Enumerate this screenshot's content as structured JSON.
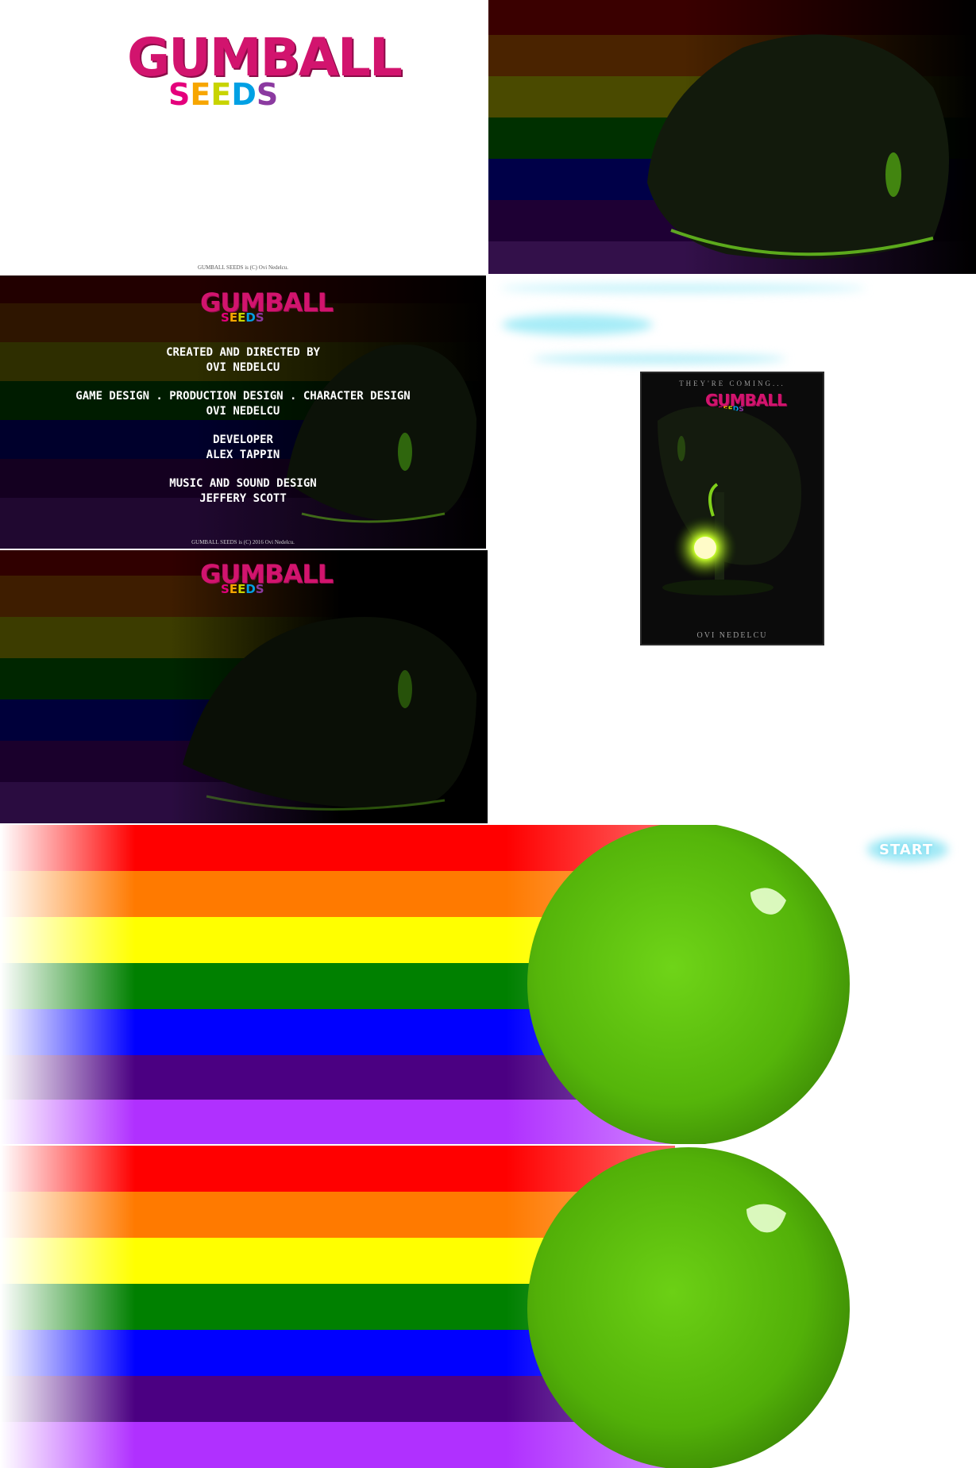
{
  "logo": {
    "top": "GUMBALL",
    "seeds_letters": [
      {
        "ch": "S",
        "color": "#e4007c"
      },
      {
        "ch": "E",
        "color": "#f7a600"
      },
      {
        "ch": "E",
        "color": "#c8d400"
      },
      {
        "ch": "D",
        "color": "#00a0e4"
      },
      {
        "ch": "S",
        "color": "#8b3aa0"
      }
    ]
  },
  "title_screen": {
    "copyright": "GUMBALL SEEDS is (C) Ovi Nedelcu."
  },
  "credits_screen": {
    "copyright": "GUMBALL SEEDS is (C) 2016 Ovi Nedelcu.",
    "roles": [
      {
        "title": "Created and Directed by",
        "name": "Ovi Nedelcu"
      },
      {
        "title": "Game Design . Production Design . Character Design",
        "name": "Ovi Nedelcu"
      },
      {
        "title": "Developer",
        "name": "Alex Tappin"
      },
      {
        "title": "Music and Sound Design",
        "name": "Jeffery Scott"
      }
    ]
  },
  "poster": {
    "tagline": "THEY'RE COMING...",
    "credit": "OVI NEDELCU"
  },
  "start_button": {
    "label": "START"
  },
  "colors": {
    "rainbow": [
      "#ff0000",
      "#ff7a00",
      "#ffff00",
      "#008000",
      "#0000ff",
      "#4b0082",
      "#b030ff"
    ],
    "gumball_green": "#5fc10a",
    "brand_pink": "#d2146e",
    "glow_cyan": "#9fe8f5"
  }
}
